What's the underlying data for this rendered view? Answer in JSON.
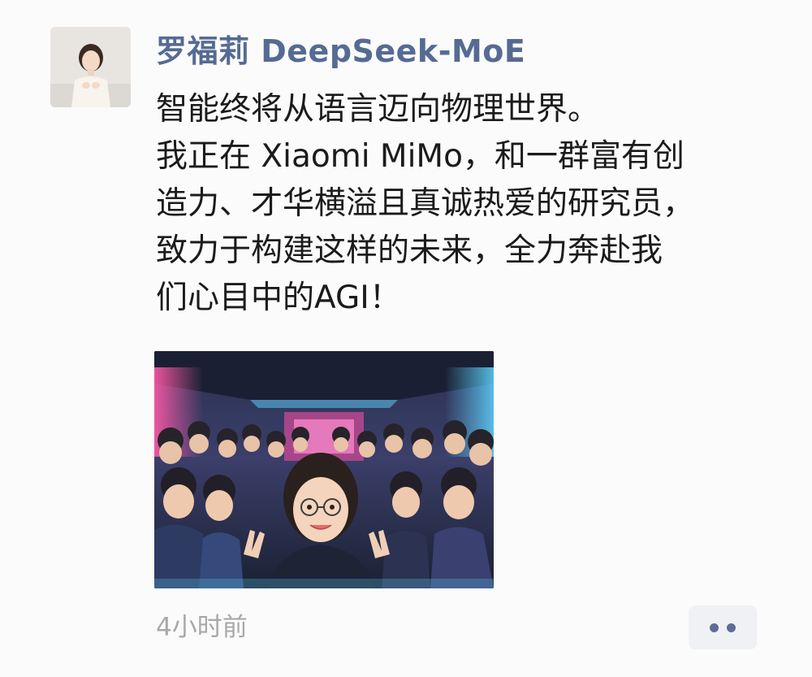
{
  "post": {
    "author": "罗福莉 DeepSeek-MoE",
    "text_lines": [
      "智能终将从语言迈向物理世界。",
      "我正在 Xiaomi MiMo，和一群富有创",
      "造力、才华横溢且真诚热爱的研究员，",
      "致力于构建这样的未来，全力奔赴我",
      "们心目中的AGI！"
    ],
    "time": "4小时前",
    "more_icon": "ellipsis-icon"
  },
  "colors": {
    "author": "#566b93",
    "text": "#1b1b1b",
    "time": "#a8a8a8",
    "more_bg": "#f0f1f5",
    "more_dots": "#5c6e95"
  }
}
